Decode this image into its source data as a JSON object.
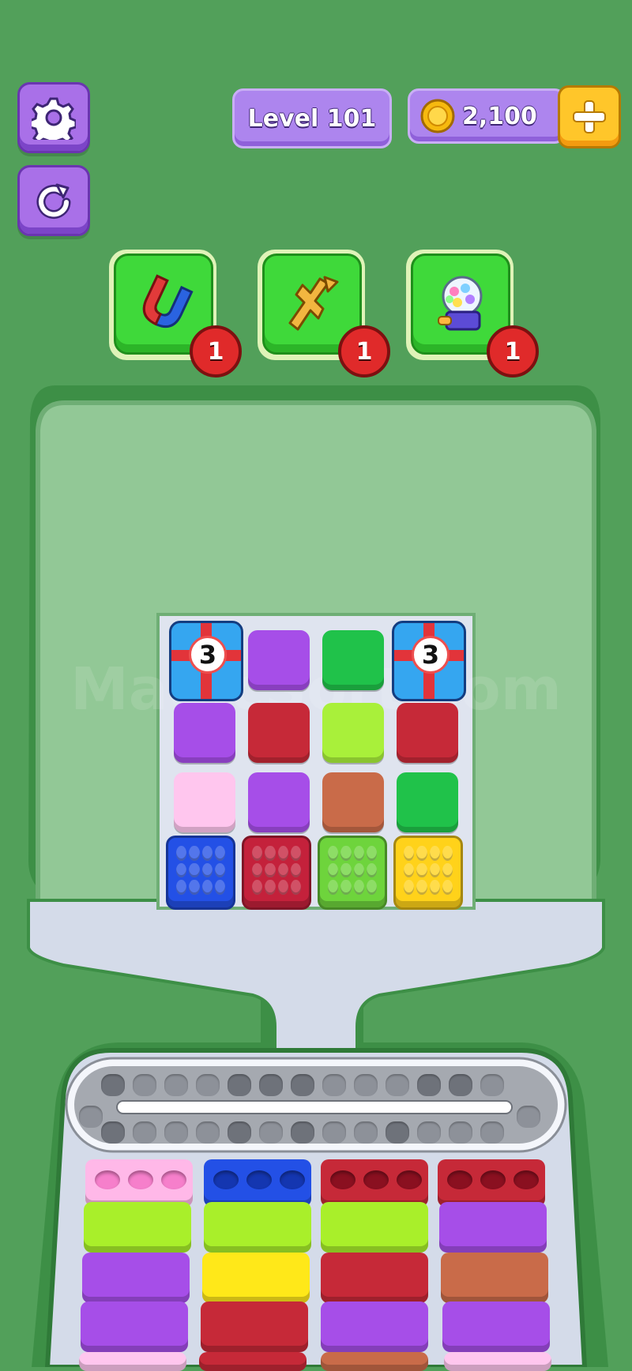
{
  "header": {
    "level_label": "Level 101",
    "coins": "2,100"
  },
  "icons": [
    "gear-icon",
    "restart-icon",
    "coin-icon",
    "plus-icon",
    "magnet-icon",
    "shuffle-icon",
    "gumball-icon"
  ],
  "boosters": [
    {
      "name": "magnet",
      "count": "1"
    },
    {
      "name": "shuffle",
      "count": "1"
    },
    {
      "name": "gumball",
      "count": "1"
    }
  ],
  "board": {
    "gift_counts": [
      "3",
      "3"
    ],
    "tile_colors": {
      "purple": "#a64ee8",
      "green": "#20c24a",
      "lime": "#a9f03a",
      "crimson": "#c62938",
      "pink": "#ffc6ee",
      "brown": "#c96b49",
      "blue": "#2350e6",
      "red": "#c4213b",
      "yellow": "#ffd21a"
    }
  },
  "watermark": "MagicSort.com"
}
